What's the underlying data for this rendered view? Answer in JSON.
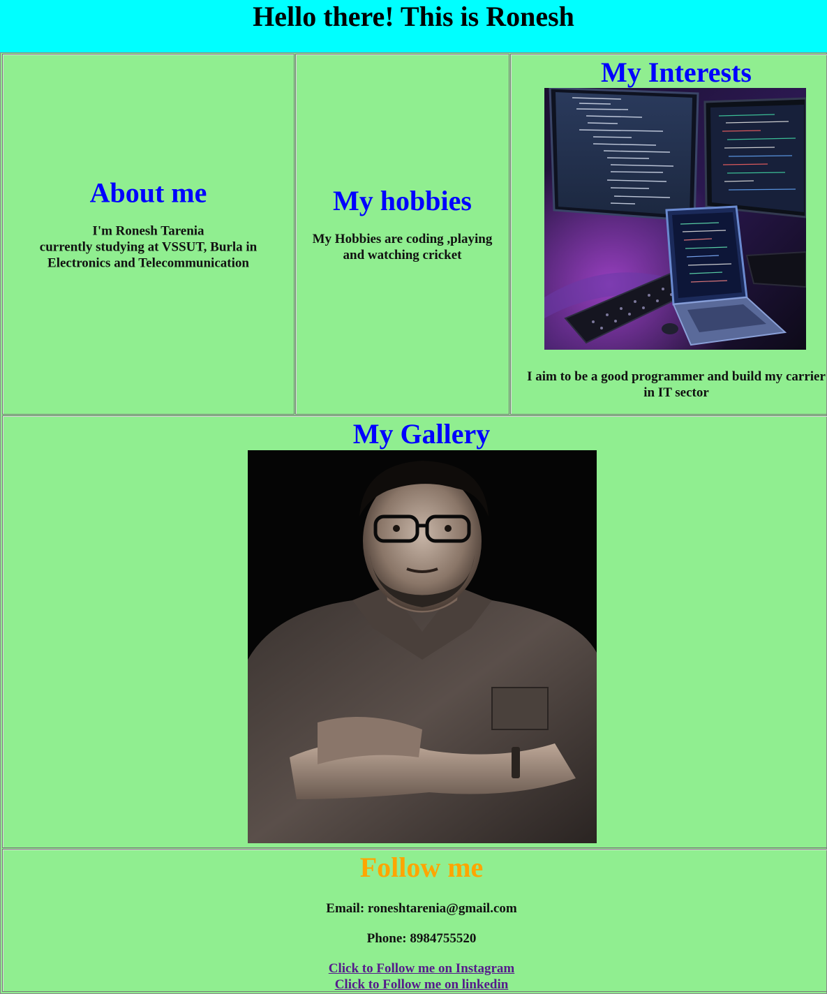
{
  "header": {
    "title": "Hello there! This is Ronesh"
  },
  "about": {
    "title": "About me",
    "line1": "I'm Ronesh Tarenia",
    "line2": "currently studying at VSSUT, Burla in",
    "line3": "Electronics and Telecommunication"
  },
  "hobbies": {
    "title": "My hobbies",
    "line1": "My Hobbies are coding ,playing",
    "line2": "and watching cricket"
  },
  "interests": {
    "title": "My Interests",
    "image_alt": "coding setup with monitors and laptop",
    "line1": "I aim to be a good programmer and build my carrier",
    "line2": "in IT sector"
  },
  "gallery": {
    "title": "My Gallery",
    "image_alt": "portrait photo of Ronesh"
  },
  "follow": {
    "title": "Follow me",
    "title_color": "#ffa500",
    "email": "Email: roneshtarenia@gmail.com",
    "phone": "Phone: 8984755520",
    "instagram_link": "Click to Follow me on Instagram",
    "linkedin_link": "Click to Follow me on linkedin"
  },
  "colors": {
    "header_bg": "#00ffff",
    "page_bg": "#90ee90",
    "heading": "#0000ff",
    "link": "#551a8b"
  }
}
